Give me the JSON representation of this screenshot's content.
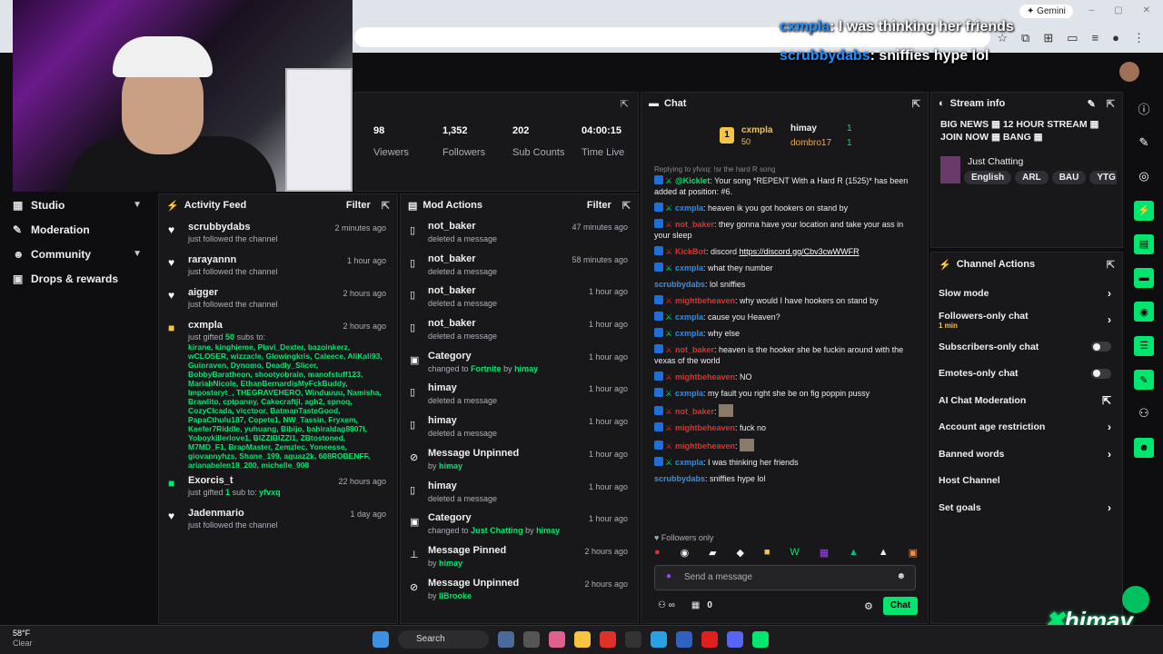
{
  "browser": {
    "gemini_label": "Gemini",
    "window_controls": [
      "–",
      "▢",
      "✕"
    ]
  },
  "overlay_chat": [
    {
      "user": "cxmpla",
      "text": "I was thinking her friends"
    },
    {
      "user": "scrubbydabs",
      "text": "sniffies hype lol"
    }
  ],
  "sidebar": {
    "items": [
      {
        "label": "Studio",
        "icon": "studio-icon",
        "expandable": true
      },
      {
        "label": "Moderation",
        "icon": "wrench-icon",
        "expandable": false
      },
      {
        "label": "Community",
        "icon": "people-icon",
        "expandable": true
      },
      {
        "label": "Drops & rewards",
        "icon": "gift-icon",
        "expandable": false
      }
    ]
  },
  "stats": [
    {
      "value": "98",
      "label": "Viewers"
    },
    {
      "value": "1,352",
      "label": "Followers"
    },
    {
      "value": "202",
      "label": "Sub Counts"
    },
    {
      "value": "04:00:15",
      "label": "Time Live"
    }
  ],
  "activity": {
    "title": "Activity Feed",
    "filter_label": "Filter",
    "items": [
      {
        "name": "scrubbydabs",
        "desc": "just followed the channel",
        "time": "2 minutes ago",
        "icon": "heart-icon"
      },
      {
        "name": "rarayannn",
        "desc": "just followed the channel",
        "time": "1 hour ago",
        "icon": "heart-icon"
      },
      {
        "name": "aigger",
        "desc": "just followed the channel",
        "time": "2 hours ago",
        "icon": "heart-icon"
      },
      {
        "name": "cxmpla",
        "desc_pre": "just gifted",
        "desc_count": "50",
        "desc_post": "subs to:",
        "time": "2 hours ago",
        "icon": "gift-icon",
        "gifts": "kirane, kinghieme, Plavi_Dexter, bazoinkerz, wCLOSER, wizzacle, Glowingkris, Caleece, AliKali93, Guinraven, Dynomo, Deadly_Slicer, BobbyBaratheon, shootyobrain, manofstuff123, MariahNicole, EthanBernardisMyFckBuddy, Imposteryt_, THEGRAVEHERO, Winduuuu, Namisha, Brawlito, cptpanny, Cakecraftjl, agh2, spnoq, CozyClcada, vicctoor, BatmanTasteGood, PapaCthulu187, Copete1, NW_Tassin, Fryxem, Keefer7Riddle, yuhuang, Bibijo, bahiraldag8807l, Yoboykillerlove1, BIZZIBIZZI1, ZBtostoned, M7MD_F1, BrapMaster, Zemzlec, Yoneesse, giovannyhzs, Shane_199, aquaz2k, 608ROBENFF, arianabelen18_200, michelle_908"
      },
      {
        "name": "Exorcis_t",
        "desc_pre": "just gifted",
        "desc_count": "1",
        "desc_post": "sub to:",
        "desc_target": "yfvxq",
        "time": "22 hours ago",
        "icon": "gift-icon"
      },
      {
        "name": "Jadenmario",
        "desc": "just followed the channel",
        "time": "1 day ago",
        "icon": "heart-icon"
      }
    ]
  },
  "mod": {
    "title": "Mod Actions",
    "filter_label": "Filter",
    "items": [
      {
        "name": "not_baker",
        "desc": "deleted a message",
        "time": "47 minutes ago",
        "icon": "trash-icon"
      },
      {
        "name": "not_baker",
        "desc": "deleted a message",
        "time": "58 minutes ago",
        "icon": "trash-icon"
      },
      {
        "name": "not_baker",
        "desc": "deleted a message",
        "time": "1 hour ago",
        "icon": "trash-icon"
      },
      {
        "name": "not_baker",
        "desc": "deleted a message",
        "time": "1 hour ago",
        "icon": "trash-icon"
      },
      {
        "name": "Category",
        "desc": "changed to",
        "hl": "Fortnite",
        "by": "by",
        "byuser": "himay",
        "time": "1 hour ago",
        "icon": "category-icon"
      },
      {
        "name": "himay",
        "desc": "deleted a message",
        "time": "1 hour ago",
        "icon": "trash-icon"
      },
      {
        "name": "himay",
        "desc": "deleted a message",
        "time": "1 hour ago",
        "icon": "trash-icon"
      },
      {
        "name": "Message Unpinned",
        "desc": "by",
        "hl": "himay",
        "time": "1 hour ago",
        "icon": "unpin-icon"
      },
      {
        "name": "himay",
        "desc": "deleted a message",
        "time": "1 hour ago",
        "icon": "trash-icon"
      },
      {
        "name": "Category",
        "desc": "changed to",
        "hl": "Just Chatting",
        "by": "by",
        "byuser": "himay",
        "time": "1 hour ago",
        "icon": "category-icon"
      },
      {
        "name": "Message Pinned",
        "desc": "by",
        "hl": "himay",
        "time": "2 hours ago",
        "icon": "pin-icon"
      },
      {
        "name": "Message Unpinned",
        "desc": "by",
        "hl": "IlBrooke",
        "time": "2 hours ago",
        "icon": "unpin-icon"
      }
    ]
  },
  "chat": {
    "title": "Chat",
    "pinned": [
      {
        "user": "cxmpla",
        "val": "50"
      },
      {
        "user": "himay",
        "val": "1"
      },
      {
        "user": "dombro17",
        "val": "1"
      }
    ],
    "pinned_badge": "1",
    "reply_note": "Replying to yfvxq: !sr the hard R song",
    "messages": [
      {
        "user": "@Kicklet",
        "color": "grn",
        "text": "Your song *REPENT With a Hard R (1525)* has been added at position: #6."
      },
      {
        "user": "cxmpla",
        "color": "blue",
        "text": "heaven ik you got hookers on stand by"
      },
      {
        "user": "not_baker",
        "color": "red",
        "text": "they gonna have your location and take your ass in your sleep"
      },
      {
        "user": "KickBot",
        "color": "red",
        "text": "discord",
        "link": "https://discord.gg/Cbv3cwWWFR"
      },
      {
        "user": "cxmpla",
        "color": "blue",
        "text": "what they number"
      },
      {
        "user": "scrubbydabs",
        "color": "lblue",
        "text": "lol sniffies"
      },
      {
        "user": "mightbeheaven",
        "color": "red",
        "text": "why would I have hookers on stand by"
      },
      {
        "user": "cxmpla",
        "color": "blue",
        "text": "cause you Heaven?"
      },
      {
        "user": "cxmpla",
        "color": "blue",
        "text": "why else"
      },
      {
        "user": "not_baker",
        "color": "red",
        "text": "heaven is the hooker she be fuckin around with the vexas of the world"
      },
      {
        "user": "mightbeheaven",
        "color": "red",
        "text": "NO"
      },
      {
        "user": "cxmpla",
        "color": "blue",
        "text": "my fault you right she be on fig poppin pussy"
      },
      {
        "user": "not_baker",
        "color": "red",
        "text": ""
      },
      {
        "user": "mightbeheaven",
        "color": "red",
        "text": "fuck no"
      },
      {
        "user": "mightbeheaven",
        "color": "red",
        "text": ""
      },
      {
        "user": "cxmpla",
        "color": "blue",
        "text": "I was thinking her friends"
      },
      {
        "user": "scrubbydabs",
        "color": "lblue",
        "text": "sniffies hype lol"
      }
    ],
    "followers_only": "Followers only",
    "input_placeholder": "Send a message",
    "points": "0",
    "send_label": "Chat"
  },
  "stream_info": {
    "title": "Stream info",
    "stream_title": "BIG NEWS ▦ 12 HOUR STREAM ▦ JOIN NOW ▦ BANG ▦",
    "category": "Just Chatting",
    "tags": [
      "English",
      "ARL",
      "BAU",
      "YTG"
    ]
  },
  "channel_actions": {
    "title": "Channel Actions",
    "items": [
      {
        "label": "Slow mode",
        "sub": "",
        "ctl": "chevron"
      },
      {
        "label": "Followers-only chat",
        "sub": "1 min",
        "ctl": "chevron"
      },
      {
        "label": "Subscribers-only chat",
        "sub": "",
        "ctl": "toggle"
      },
      {
        "label": "Emotes-only chat",
        "sub": "",
        "ctl": "toggle"
      },
      {
        "label": "AI Chat Moderation",
        "sub": "",
        "ctl": "popout"
      },
      {
        "label": "Account age restriction",
        "sub": "",
        "ctl": "chevron"
      },
      {
        "label": "Banned words",
        "sub": "",
        "ctl": "chevron"
      },
      {
        "label": "Host Channel",
        "sub": "",
        "ctl": "none"
      },
      {
        "label": "Set goals",
        "sub": "",
        "ctl": "chevron"
      }
    ]
  },
  "brand": {
    "name": "himay",
    "accent": "#00e66e"
  },
  "taskbar": {
    "temp": "58°F",
    "condition": "Clear",
    "search": "Search"
  }
}
